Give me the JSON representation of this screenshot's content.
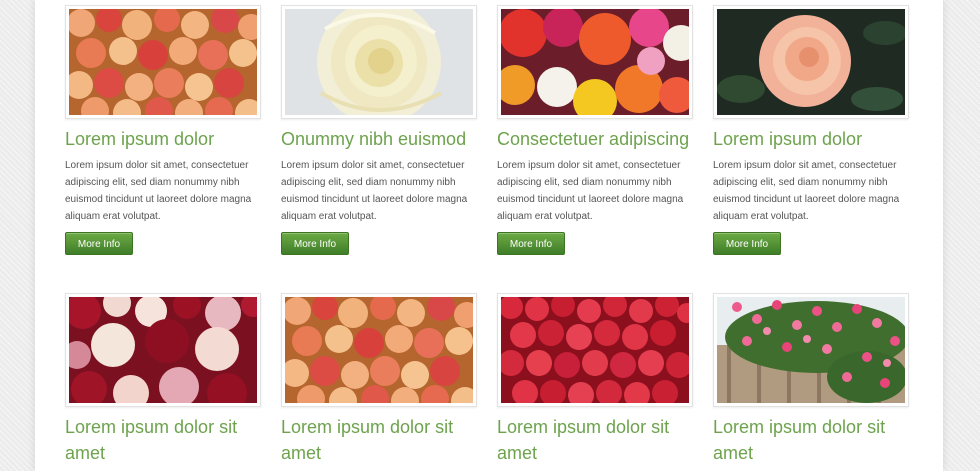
{
  "colors": {
    "accent_green": "#6da34d",
    "button_green": "#4c8a32",
    "body_text": "#555555",
    "page_bg": "#ececec"
  },
  "row1": [
    {
      "title": "Lorem ipsum dolor",
      "image_desc": "peach and red roses bouquet",
      "text": "Lorem ipsum dolor sit amet, consectetuer adipiscing elit, sed diam nonummy nibh euismod tincidunt ut laoreet dolore magna aliquam erat volutpat.",
      "button": "More Info"
    },
    {
      "title": "Onummy nibh euismod",
      "image_desc": "white cream rose",
      "text": "Lorem ipsum dolor sit amet, consectetuer adipiscing elit, sed diam nonummy nibh euismod tincidunt ut laoreet dolore magna aliquam erat volutpat.",
      "button": "More Info"
    },
    {
      "title": "Consectetuer adipiscing",
      "image_desc": "multicolor roses",
      "text": "Lorem ipsum dolor sit amet, consectetuer adipiscing elit, sed diam nonummy nibh euismod tincidunt ut laoreet dolore magna aliquam erat volutpat.",
      "button": "More Info"
    },
    {
      "title": "Lorem ipsum dolor",
      "image_desc": "single peach rose on dark leaves",
      "text": "Lorem ipsum dolor sit amet, consectetuer adipiscing elit, sed diam nonummy nibh euismod tincidunt ut laoreet dolore magna aliquam erat volutpat.",
      "button": "More Info"
    }
  ],
  "row2": [
    {
      "title": "Lorem ipsum dolor sit amet",
      "image_desc": "red and white roses"
    },
    {
      "title": "Lorem ipsum dolor sit amet",
      "image_desc": "peach and red roses bouquet"
    },
    {
      "title": "Lorem ipsum dolor sit amet",
      "image_desc": "red roses"
    },
    {
      "title": "Lorem ipsum dolor sit amet",
      "image_desc": "pink climbing roses on fence"
    }
  ]
}
